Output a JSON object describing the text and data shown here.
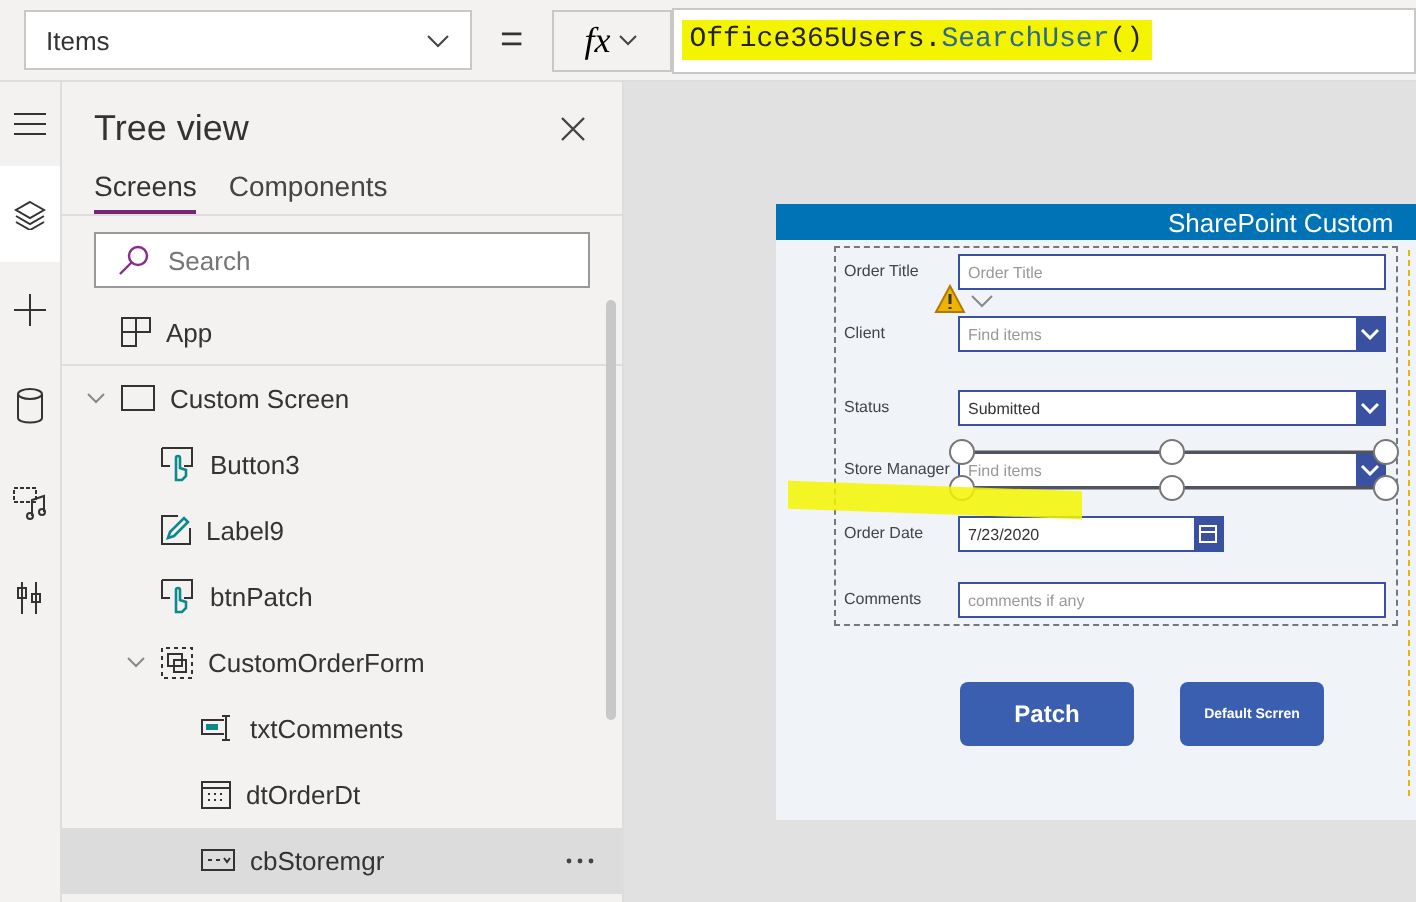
{
  "formula_bar": {
    "property": "Items",
    "equals": "=",
    "fx_label": "fx",
    "formula": [
      {
        "text": "Office365Users.",
        "kind": "plain"
      },
      {
        "text": "SearchUser",
        "kind": "function"
      },
      {
        "text": "()",
        "kind": "plain"
      }
    ],
    "highlighted": true
  },
  "rail": [
    {
      "kind": "menu",
      "selected": false
    },
    {
      "kind": "layers",
      "selected": true
    },
    {
      "kind": "plus",
      "selected": false
    },
    {
      "kind": "database",
      "selected": false
    },
    {
      "kind": "media",
      "selected": false
    },
    {
      "kind": "tools",
      "selected": false
    }
  ],
  "tree_view": {
    "title": "Tree view",
    "tabs": [
      {
        "label": "Screens",
        "selected": true
      },
      {
        "label": "Components",
        "selected": false
      }
    ],
    "search": {
      "placeholder": "Search"
    },
    "items": [
      {
        "label": "App",
        "kind": "app",
        "selected": false
      },
      {
        "label": "Custom Screen",
        "kind": "screen",
        "selected": false,
        "expanded": true,
        "children": [
          {
            "label": "Button3",
            "kind": "button",
            "selected": false
          },
          {
            "label": "Label9",
            "kind": "label",
            "selected": false
          },
          {
            "label": "btnPatch",
            "kind": "button",
            "selected": false
          },
          {
            "label": "CustomOrderForm",
            "kind": "form",
            "selected": false,
            "expanded": true,
            "children": [
              {
                "label": "txtComments",
                "kind": "textinput",
                "selected": false
              },
              {
                "label": "dtOrderDt",
                "kind": "date",
                "selected": false
              },
              {
                "label": "cbStoremgr",
                "kind": "combo",
                "selected": true
              }
            ]
          }
        ]
      }
    ]
  },
  "app_screen": {
    "header": "SharePoint Custom",
    "fields": [
      {
        "label": "Order Title",
        "kind": "text",
        "placeholder": "Order Title"
      },
      {
        "label": "Client",
        "kind": "combo",
        "placeholder": "Find items"
      },
      {
        "label": "Status",
        "kind": "dropdown",
        "value": "Submitted"
      },
      {
        "label": "Store Manager",
        "kind": "combo",
        "placeholder": "Find items",
        "selected": true
      },
      {
        "label": "Order Date",
        "kind": "date",
        "value": "7/23/2020"
      },
      {
        "label": "Comments",
        "kind": "text",
        "placeholder": "comments if any"
      }
    ],
    "warning": true,
    "highlighted": true,
    "buttons": [
      {
        "label": "Patch",
        "kind": "large"
      },
      {
        "label": "Default Scrren",
        "kind": "small"
      }
    ]
  }
}
